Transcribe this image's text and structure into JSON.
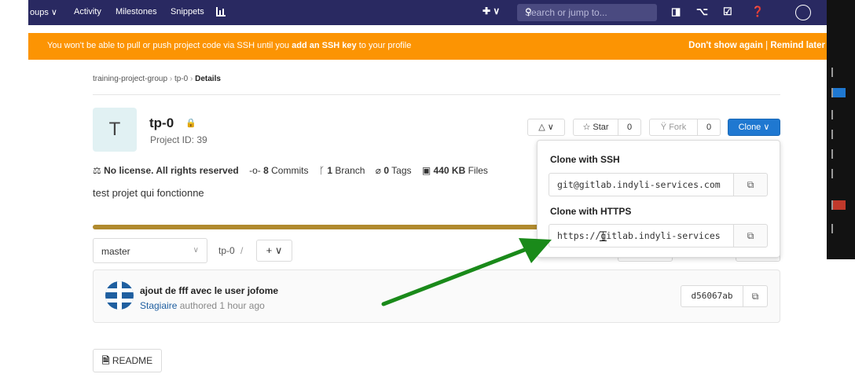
{
  "nav": {
    "items": [
      "oups ∨",
      "Activity",
      "Milestones",
      "Snippets"
    ],
    "chart_icon": "chart-icon",
    "plus_label": "✚ ∨",
    "search_placeholder": "Search or jump to...",
    "icons": [
      "issues-icon",
      "merge-request-icon",
      "todo-icon",
      "help-icon",
      "avatar-icon"
    ]
  },
  "banner": {
    "pre": "You won't be able to pull or push project code via SSH until you ",
    "link": "add an SSH key",
    "post": " to your profile",
    "dont_show": "Don't show again",
    "separator": "|",
    "remind": "Remind later"
  },
  "breadcrumb": {
    "group": "training-project-group",
    "project": "tp-0",
    "current": "Details",
    "sep": "›"
  },
  "project": {
    "avatar_letter": "T",
    "name": "tp-0",
    "id_label": "Project ID: 39",
    "license": "No license. All rights reserved",
    "commits_count": "8",
    "commits_label": "Commits",
    "branch_count": "1",
    "branch_label": "Branch",
    "tags_count": "0",
    "tags_label": "Tags",
    "size": "440 KB",
    "size_label": "Files",
    "description": "test projet qui fonctionne"
  },
  "actions": {
    "notify": "△ ∨",
    "star_label": "☆ Star",
    "star_count": "0",
    "fork_label": "Fork",
    "fork_count": "0",
    "clone_label": "Clone ∨"
  },
  "clone": {
    "ssh_label": "Clone with SSH",
    "ssh_url": "git@gitlab.indyli-services.com",
    "https_label": "Clone with HTTPS",
    "https_url": "https://gitlab.indyli-services"
  },
  "repo": {
    "branch": "master",
    "path": "tp-0",
    "path_sep": "/",
    "add_label": "+ ∨"
  },
  "commit": {
    "title": "ajout de fff avec le user jofome",
    "author": "Stagiaire",
    "meta": "authored 1 hour ago",
    "sha": "d56067ab"
  },
  "readme": {
    "label": "README"
  },
  "colors": {
    "nav_bg": "#292961",
    "banner_bg": "#fc9403",
    "clone_button": "#1f78d1",
    "arrow": "#1a8a1a",
    "language_bar": "#b08a2e"
  }
}
